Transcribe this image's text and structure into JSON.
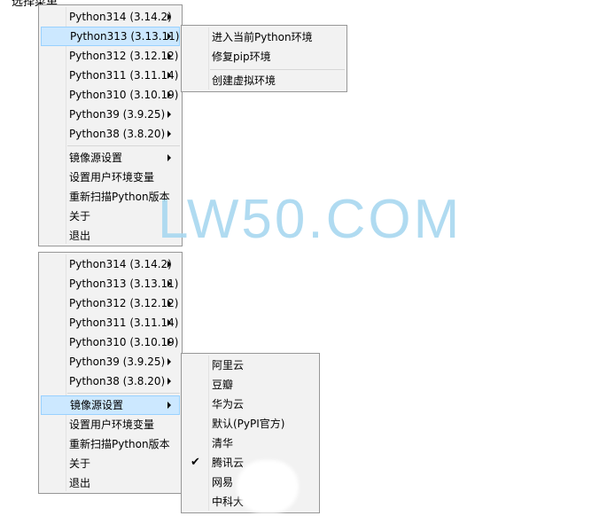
{
  "top_menu": {
    "items": [
      {
        "label": "Python314 (3.14.2)",
        "submenu": true
      },
      {
        "label": "Python313 (3.13.11)",
        "submenu": true,
        "highlighted": true
      },
      {
        "label": "Python312 (3.12.12)",
        "submenu": true
      },
      {
        "label": "Python311 (3.11.14)",
        "submenu": true
      },
      {
        "label": "Python310 (3.10.19)",
        "submenu": true
      },
      {
        "label": "Python39 (3.9.25)",
        "submenu": true
      },
      {
        "label": "Python38 (3.8.20)",
        "submenu": true
      },
      {
        "label": "镜像源设置",
        "submenu": true
      },
      {
        "label": "设置用户环境变量"
      },
      {
        "label": "重新扫描Python版本"
      },
      {
        "label": "关于"
      },
      {
        "label": "退出"
      }
    ]
  },
  "env_submenu": {
    "items": [
      "进入当前Python环境",
      "修复pip环境",
      "创建虚拟环境"
    ]
  },
  "bottom_menu": {
    "items": [
      {
        "label": "Python314 (3.14.2)",
        "submenu": true
      },
      {
        "label": "Python313 (3.13.11)",
        "submenu": true
      },
      {
        "label": "Python312 (3.12.12)",
        "submenu": true
      },
      {
        "label": "Python311 (3.11.14)",
        "submenu": true
      },
      {
        "label": "Python310 (3.10.19)",
        "submenu": true
      },
      {
        "label": "Python39 (3.9.25)",
        "submenu": true
      },
      {
        "label": "Python38 (3.8.20)",
        "submenu": true
      },
      {
        "label": "镜像源设置",
        "submenu": true,
        "highlighted": true
      },
      {
        "label": "设置用户环境变量"
      },
      {
        "label": "重新扫描Python版本"
      },
      {
        "label": "关于"
      },
      {
        "label": "退出"
      }
    ]
  },
  "mirror_submenu": {
    "items": [
      "阿里云",
      "豆瓣",
      "华为云",
      "默认(PyPI官方)",
      "清华",
      "腾讯云",
      "网易",
      "中科大"
    ],
    "checked_index": 5
  },
  "watermark": "LW50.COM",
  "colors": {
    "highlight": "#cce8ff",
    "highlight_border": "#99d1ff",
    "menu_bg": "#f2f2f2",
    "watermark": "#a8d8f0"
  }
}
